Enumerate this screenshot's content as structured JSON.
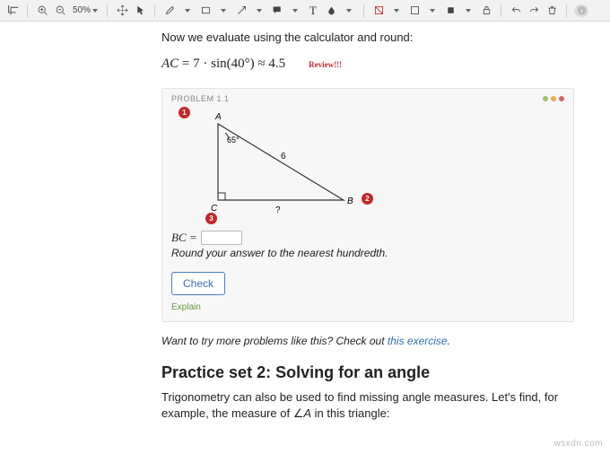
{
  "toolbar": {
    "zoom": "50%"
  },
  "content": {
    "intro": "Now we evaluate using the calculator and round:",
    "equation": "AC = 7 · sin(40°) ≈ 4.5",
    "review_label": "Review!!!"
  },
  "problem": {
    "head": "PROBLEM 1.1",
    "markers": [
      "1",
      "2",
      "3"
    ],
    "triangle": {
      "A": "A",
      "B": "B",
      "C": "C",
      "angle": "65°",
      "side_b": "6",
      "side_q": "?"
    },
    "bc_label": "BC =",
    "hint": "Round your answer to the nearest hundredth.",
    "check": "Check",
    "explain": "Explain"
  },
  "more": {
    "text_pre": "Want to try more problems like this? Check out ",
    "link": "this exercise",
    "text_post": "."
  },
  "section2": {
    "title": "Practice set 2: Solving for an angle",
    "body_pre": "Trigonometry can also be used to find missing angle measures. Let's find, for example, the measure of ∠",
    "body_ital": "A",
    "body_post": " in this triangle:"
  },
  "watermark": "wsxdn.com"
}
